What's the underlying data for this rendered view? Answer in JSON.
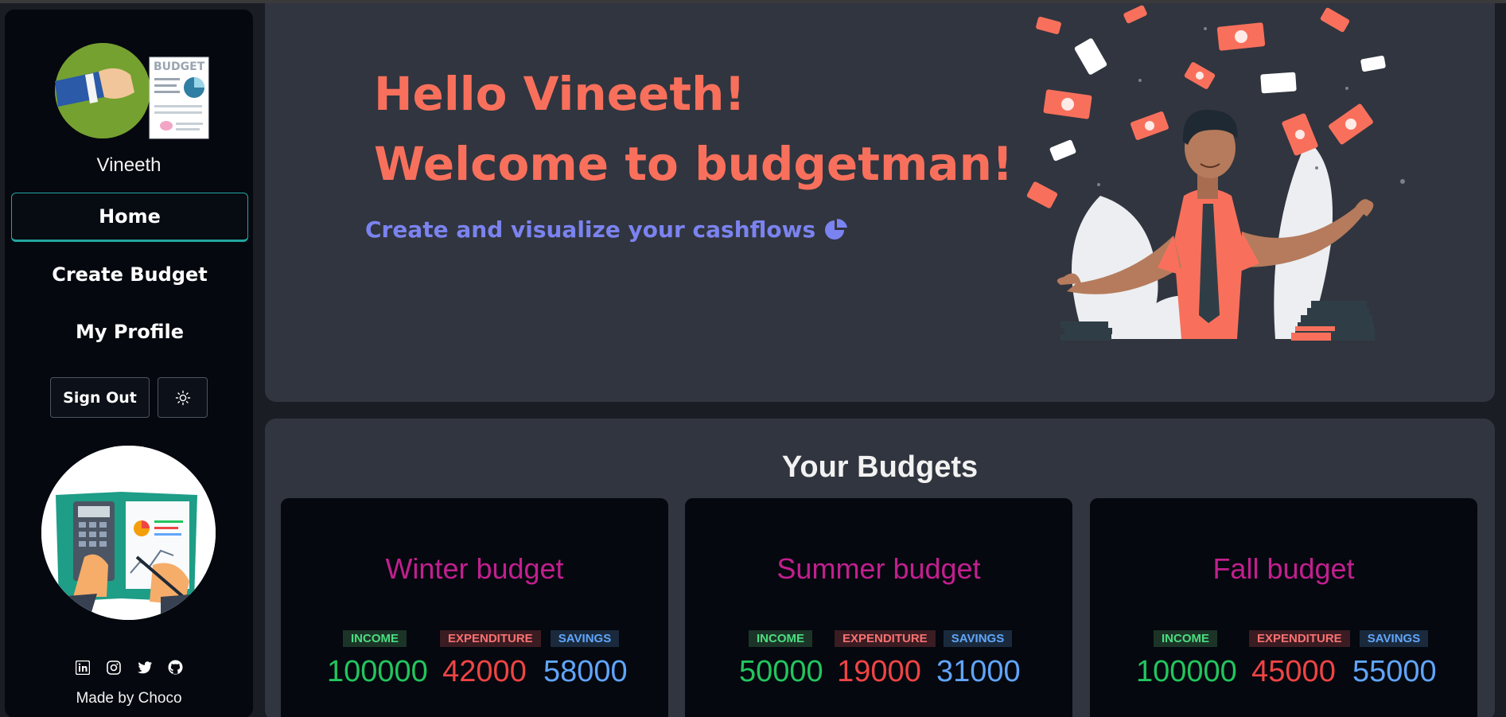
{
  "sidebar": {
    "logo_text": "BUDGET",
    "username": "Vineeth",
    "nav": [
      {
        "label": "Home"
      },
      {
        "label": "Create Budget"
      },
      {
        "label": "My Profile"
      }
    ],
    "signout_label": "Sign Out",
    "theme_icon": "sun-icon",
    "socials": [
      "linkedin-icon",
      "instagram-icon",
      "twitter-icon",
      "github-icon"
    ],
    "footer": "Made by Choco"
  },
  "hero": {
    "greeting": "Hello Vineeth!",
    "welcome": "Welcome to budgetman!",
    "tagline": "Create and visualize your cashflows",
    "tagline_icon": "pie-chart-icon"
  },
  "budgets": {
    "title": "Your Budgets",
    "labels": {
      "income": "INCOME",
      "expenditure": "EXPENDITURE",
      "savings": "SAVINGS"
    },
    "cards": [
      {
        "name": "Winter budget",
        "income": "100000",
        "expenditure": "42000",
        "savings": "58000"
      },
      {
        "name": "Summer budget",
        "income": "50000",
        "expenditure": "19000",
        "savings": "31000"
      },
      {
        "name": "Fall budget",
        "income": "100000",
        "expenditure": "45000",
        "savings": "55000"
      }
    ]
  },
  "colors": {
    "accent_coral": "#f8705c",
    "accent_violet": "#7b83f0",
    "budget_title": "#c21f8f",
    "income": "#22c55e",
    "expenditure": "#ef4444",
    "savings": "#60a5fa",
    "nav_active": "#21a6a0"
  }
}
